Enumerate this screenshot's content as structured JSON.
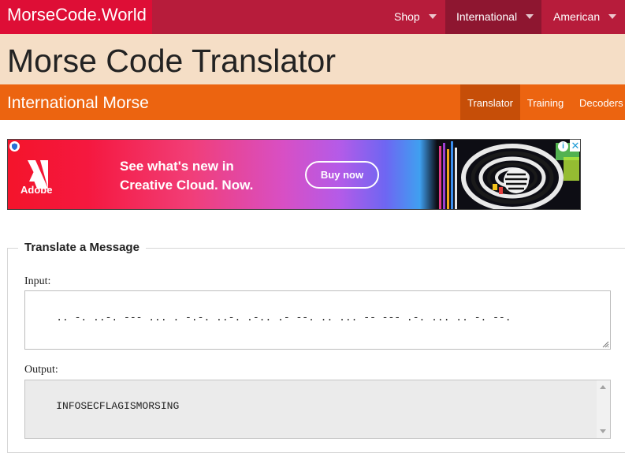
{
  "topnav": {
    "brand": "MorseCode.World",
    "items": [
      {
        "label": "Shop"
      },
      {
        "label": "International",
        "active": true
      },
      {
        "label": "American"
      }
    ]
  },
  "page_title": "Morse Code Translator",
  "subnav": {
    "section_title": "International Morse",
    "items": [
      {
        "label": "Translator",
        "active": true
      },
      {
        "label": "Training"
      },
      {
        "label": "Decoders"
      }
    ]
  },
  "ad": {
    "brand": "Adobe",
    "headline_line1": "See what's new in",
    "headline_line2": "Creative Cloud. Now.",
    "button": "Buy now",
    "info_icon": "i",
    "close_icon": "✕",
    "colors": {
      "red": "#f4142b",
      "purple": "#b45be8",
      "blue": "#3fa0f0"
    }
  },
  "translate": {
    "legend": "Translate a Message",
    "input_label": "Input:",
    "input_value": ".. -. ..-. --- ... . -.-. ..-. .-.. .- --. .. ... -- --- .-. ... .. -. --.",
    "output_label": "Output:",
    "output_value": "INFOSECFLAGISMORSING"
  },
  "colors": {
    "brand_red": "#de0e36",
    "nav_bg": "#b71c3b",
    "nav_active": "#8e1630",
    "title_bg": "#f5dec6",
    "orange": "#ec6410",
    "orange_active": "#c64e08"
  }
}
